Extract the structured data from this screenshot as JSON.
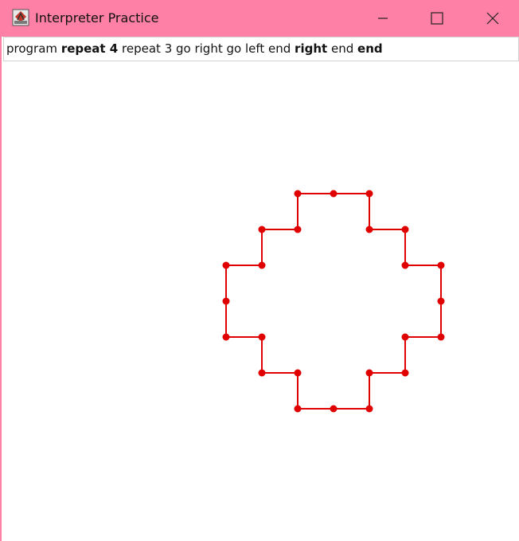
{
  "window": {
    "title": "Interpreter Practice",
    "titlebar_color": "#ff80a6",
    "app_icon": "java-app-icon",
    "controls": [
      "minimize-icon",
      "maximize-icon",
      "close-icon"
    ]
  },
  "program": {
    "tokens": [
      {
        "text": "program",
        "bold": false
      },
      {
        "text": "repeat 4",
        "bold": true
      },
      {
        "text": "repeat 3 go right go left end",
        "bold": false
      },
      {
        "text": "right",
        "bold": true
      },
      {
        "text": "end",
        "bold": false
      },
      {
        "text": "end",
        "bold": true
      }
    ]
  },
  "drawing": {
    "line_color": "#e00000",
    "point_color": "#e00000"
  }
}
